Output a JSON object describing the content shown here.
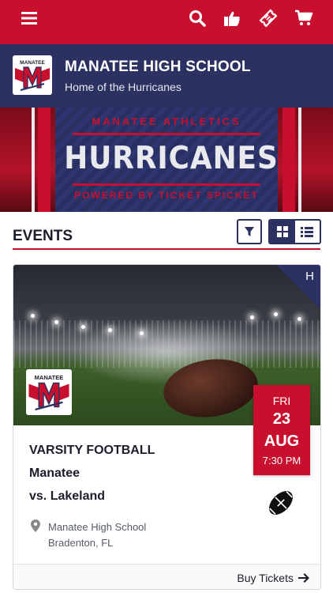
{
  "colors": {
    "brand_red": "#c8102e",
    "brand_navy": "#2b3160"
  },
  "topbar": {
    "icons": [
      "menu-icon",
      "search-icon",
      "thumbs-up-icon",
      "ticket-icon",
      "cart-icon"
    ]
  },
  "school": {
    "logo_text": "MANATEE",
    "name": "MANATEE HIGH SCHOOL",
    "tagline": "Home of the Hurricanes"
  },
  "banner": {
    "top_text": "MANATEE ATHLETICS",
    "main_text": "HURRICANES",
    "bottom_text": "POWERED BY TICKET SPICKET"
  },
  "events": {
    "heading": "EVENTS",
    "view_selected": "grid",
    "cards": [
      {
        "corner_label": "H",
        "logo_text": "MANATEE",
        "date": {
          "dow": "FRI",
          "day": "23",
          "month": "AUG",
          "time": "7:30 PM"
        },
        "event_type": "VARSITY FOOTBALL",
        "home_team": "Manatee",
        "opponent": "vs. Lakeland",
        "sport_icon": "football-icon",
        "venue_line1": "Manatee High School",
        "venue_line2": "Bradenton, FL",
        "action_label": "Buy Tickets"
      }
    ]
  }
}
